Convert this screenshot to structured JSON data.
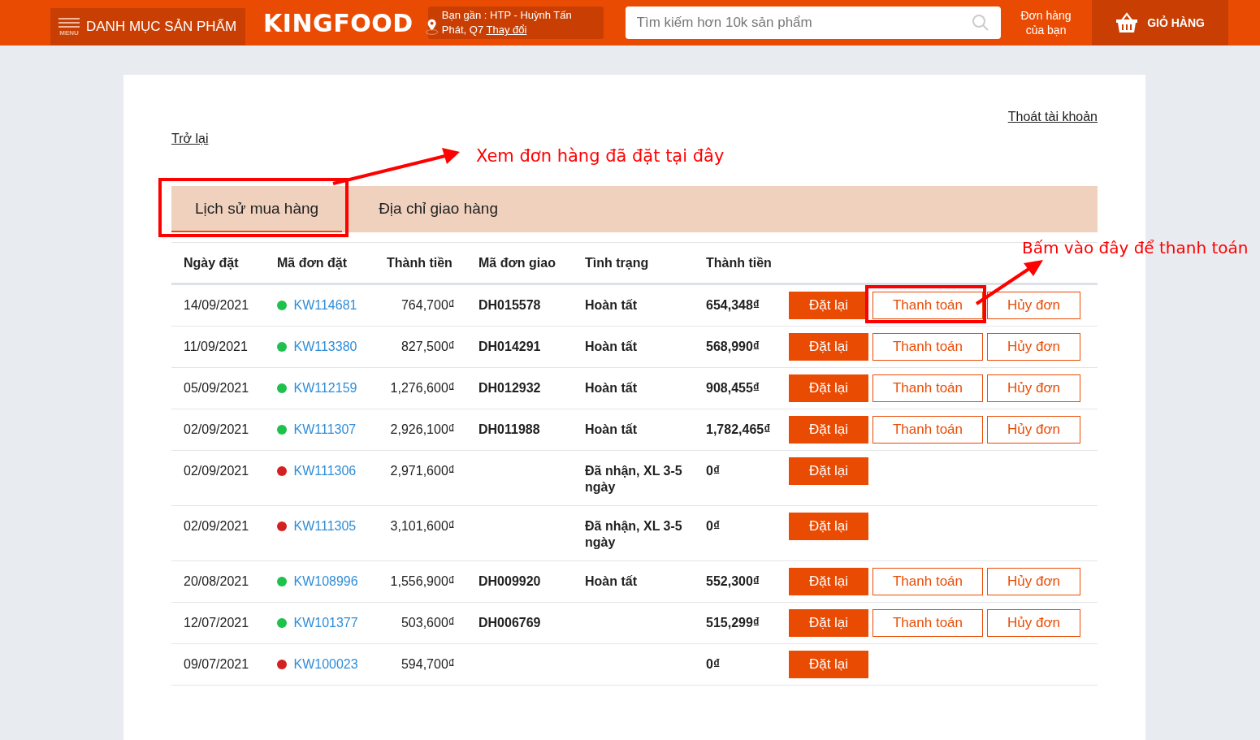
{
  "header": {
    "menu_label": "DANH MỤC SẢN PHẨM",
    "menu_caption": "MENU",
    "logo": "KINGFOOD",
    "location": {
      "text": "Bạn gần : HTP - Huỳnh Tấn Phát, Q7",
      "change_link": "Thay đổi"
    },
    "search": {
      "placeholder": "Tìm kiếm hơn 10k sản phẩm"
    },
    "orders_link": "Đơn hàng của bạn",
    "cart_label": "GIỎ HÀNG"
  },
  "back_link": "Trở lại",
  "logout_link": "Thoát tài khoản",
  "tabs": [
    {
      "label": "Lịch sử mua hàng",
      "selected": true
    },
    {
      "label": "Địa chỉ giao hàng",
      "selected": false
    }
  ],
  "table": {
    "columns": [
      "Ngày đặt",
      "Mã đơn đặt",
      "Thành tiền",
      "Mã đơn giao",
      "Tình trạng",
      "Thành tiền"
    ],
    "rows": [
      {
        "date": "14/09/2021",
        "code": "KW114681",
        "color": "#1ec14b",
        "amount": "764,700₫",
        "delivery": "DH015578",
        "status": "Hoàn tất",
        "total": "654,348₫",
        "buttons": [
          {
            "label": "Đặt lại",
            "kind": "primary"
          },
          {
            "label": "Thanh toán",
            "kind": "outline"
          },
          {
            "label": "Hủy đơn",
            "kind": "outline"
          }
        ]
      },
      {
        "date": "11/09/2021",
        "code": "KW113380",
        "color": "#1ec14b",
        "amount": "827,500₫",
        "delivery": "DH014291",
        "status": "Hoàn tất",
        "total": "568,990₫",
        "buttons": [
          {
            "label": "Đặt lại",
            "kind": "primary"
          },
          {
            "label": "Thanh toán",
            "kind": "outline"
          },
          {
            "label": "Hủy đơn",
            "kind": "outline"
          }
        ]
      },
      {
        "date": "05/09/2021",
        "code": "KW112159",
        "color": "#1ec14b",
        "amount": "1,276,600₫",
        "delivery": "DH012932",
        "status": "Hoàn tất",
        "total": "908,455₫",
        "buttons": [
          {
            "label": "Đặt lại",
            "kind": "primary"
          },
          {
            "label": "Thanh toán",
            "kind": "outline"
          },
          {
            "label": "Hủy đơn",
            "kind": "outline"
          }
        ]
      },
      {
        "date": "02/09/2021",
        "code": "KW111307",
        "color": "#1ec14b",
        "amount": "2,926,100₫",
        "delivery": "DH011988",
        "status": "Hoàn tất",
        "total": "1,782,465₫",
        "buttons": [
          {
            "label": "Đặt lại",
            "kind": "primary"
          },
          {
            "label": "Thanh toán",
            "kind": "outline"
          },
          {
            "label": "Hủy đơn",
            "kind": "outline"
          }
        ]
      },
      {
        "date": "02/09/2021",
        "code": "KW111306",
        "color": "#d42020",
        "amount": "2,971,600₫",
        "status": "Đã nhận, XL 3-5 ngày",
        "total": "0₫",
        "buttons": [
          {
            "label": "Đặt lại",
            "kind": "primary"
          }
        ]
      },
      {
        "date": "02/09/2021",
        "code": "KW111305",
        "color": "#d42020",
        "amount": "3,101,600₫",
        "status": "Đã nhận, XL 3-5 ngày",
        "total": "0₫",
        "buttons": [
          {
            "label": "Đặt lại",
            "kind": "primary"
          }
        ]
      },
      {
        "date": "20/08/2021",
        "code": "KW108996",
        "color": "#1ec14b",
        "amount": "1,556,900₫",
        "delivery": "DH009920",
        "status": "Hoàn tất",
        "total": "552,300₫",
        "buttons": [
          {
            "label": "Đặt lại",
            "kind": "primary"
          },
          {
            "label": "Thanh toán",
            "kind": "outline"
          },
          {
            "label": "Hủy đơn",
            "kind": "outline"
          }
        ]
      },
      {
        "date": "12/07/2021",
        "code": "KW101377",
        "color": "#1ec14b",
        "amount": "503,600₫",
        "delivery": "DH006769",
        "total": "515,299₫",
        "buttons": [
          {
            "label": "Đặt lại",
            "kind": "primary"
          },
          {
            "label": "Thanh toán",
            "kind": "outline"
          },
          {
            "label": "Hủy đơn",
            "kind": "outline"
          }
        ]
      },
      {
        "date": "09/07/2021",
        "code": "KW100023",
        "color": "#d42020",
        "amount": "594,700₫",
        "total": "0₫",
        "buttons": [
          {
            "label": "Đặt lại",
            "kind": "primary"
          }
        ]
      }
    ]
  },
  "annotations": [
    {
      "text": "Xem đơn hàng đã đặt tại đây"
    },
    {
      "text": "Bấm vào đây để thanh toán"
    }
  ]
}
